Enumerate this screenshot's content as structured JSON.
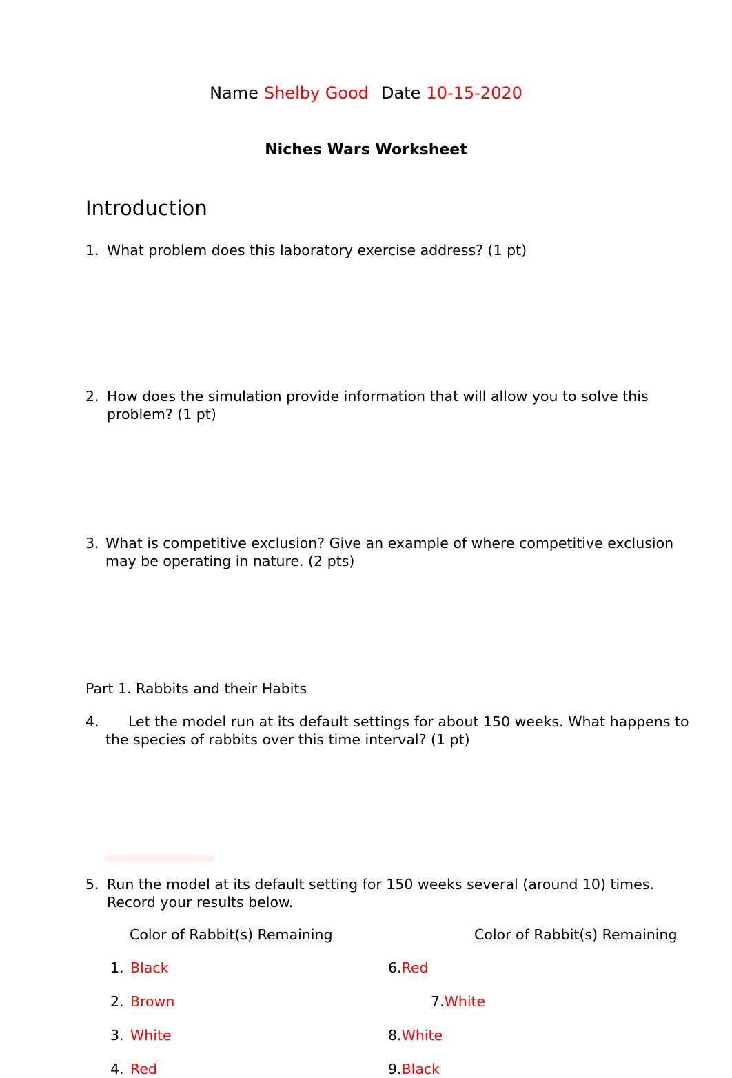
{
  "header": {
    "name_label": "Name",
    "name_value": "Shelby Good",
    "date_label": "Date",
    "date_value": "10-15-2020"
  },
  "title": "Niches Wars Worksheet",
  "sections": {
    "introduction_heading": "Introduction",
    "part1_heading": "Part 1.  Rabbits and their Habits"
  },
  "questions": [
    {
      "number": "1.",
      "text": "What problem does this laboratory exercise address? (1 pt)"
    },
    {
      "number": "2.",
      "text": "How does the simulation provide information that will allow you to solve this problem?  (1 pt)"
    },
    {
      "number": "3.",
      "text": "What is competitive exclusion?   Give an example of where competitive exclusion may be operating in nature. (2 pts)"
    },
    {
      "number": "4.",
      "text": "Let the model run at its default settings for about 150 weeks.  What happens to the species of rabbits over this time interval?  (1 pt)"
    },
    {
      "number": "5.",
      "text": "Run the model at its default setting for 150 weeks several (around 10) times.  Record your results below."
    }
  ],
  "results_table": {
    "column_header_left": "Color of Rabbit(s) Remaining",
    "column_header_right": "Color of Rabbit(s) Remaining",
    "left_column": [
      {
        "number": "1.",
        "value": "Black"
      },
      {
        "number": "2.",
        "value": "Brown"
      },
      {
        "number": "3.",
        "value": "White"
      },
      {
        "number": "4.",
        "value": "Red"
      }
    ],
    "right_column": [
      {
        "number": "6.",
        "value": "Red"
      },
      {
        "number": "7.",
        "value": "White"
      },
      {
        "number": "8.",
        "value": "White"
      },
      {
        "number": "9.",
        "value": "Black"
      }
    ]
  },
  "colors": {
    "answer_red": "#FF0000",
    "body_text": "#000000",
    "page_background": "#FFFFFF"
  }
}
